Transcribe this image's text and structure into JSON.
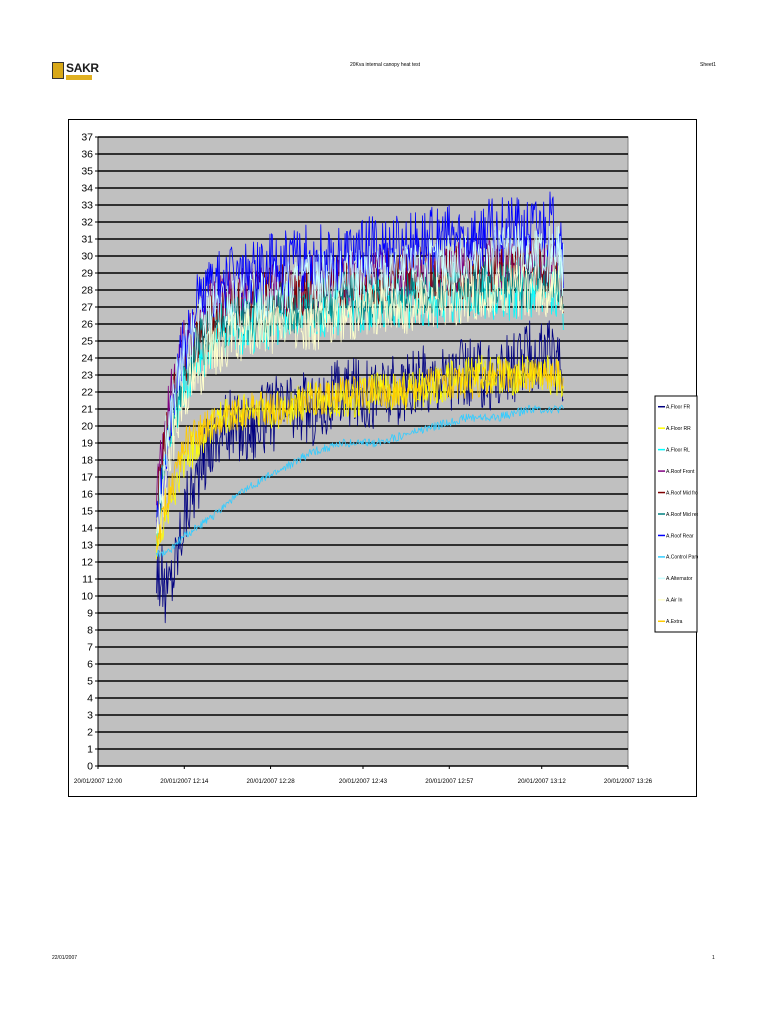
{
  "header": {
    "logo_text": "SAKR",
    "title": "20Kva internal canopy heat test",
    "sheet": "Sheet1"
  },
  "footer": {
    "date": "22/01/2007",
    "page": "1"
  },
  "chart_data": {
    "type": "line",
    "title": "",
    "xlabel": "",
    "ylabel": "",
    "ylim": [
      0,
      37
    ],
    "yticks": [
      "0",
      "1",
      "2",
      "3",
      "4",
      "5",
      "6",
      "7",
      "8",
      "9",
      "10",
      "11",
      "12",
      "13",
      "14",
      "15",
      "16",
      "17",
      "18",
      "19",
      "20",
      "21",
      "22",
      "23",
      "24",
      "25",
      "26",
      "27",
      "28",
      "29",
      "30",
      "31",
      "32",
      "33",
      "34",
      "35",
      "36",
      "37"
    ],
    "xlim": [
      "20/01/2007 12:00",
      "20/01/2007 13:26"
    ],
    "xticks": [
      "20/01/2007 12:00",
      "20/01/2007 12:14",
      "20/01/2007 12:28",
      "20/01/2007 12:43",
      "20/01/2007 12:57",
      "20/01/2007 13:12",
      "20/01/2007 13:26"
    ],
    "x_minutes": [
      9.5,
      11,
      12.5,
      14,
      16,
      18,
      21,
      25,
      30,
      35,
      40,
      45,
      50,
      55,
      60,
      65,
      70,
      75,
      75.5
    ],
    "plot_background": "#c0c0c0",
    "grid": "horizontal",
    "legend_position": "right",
    "series": [
      {
        "name": "A.Floor FR",
        "color": "#000080",
        "values": [
          12,
          10,
          12,
          15,
          17,
          19,
          20,
          20,
          21,
          21,
          22,
          22,
          22,
          23,
          23,
          23,
          24,
          24,
          23
        ]
      },
      {
        "name": "A.Floor RR",
        "color": "#ffff00",
        "values": [
          13,
          15,
          16,
          18,
          19,
          20,
          20.5,
          21,
          21,
          21.5,
          21.5,
          22,
          22,
          22.5,
          23,
          23,
          23,
          23,
          22
        ]
      },
      {
        "name": "A.Floor RL",
        "color": "#00ffff",
        "values": [
          14,
          18,
          21,
          23,
          24,
          25,
          26,
          26,
          26.5,
          27,
          27,
          27.5,
          27.5,
          27.5,
          28,
          28,
          28,
          28,
          27
        ]
      },
      {
        "name": "A.Roof Front",
        "color": "#800080",
        "values": [
          16,
          20,
          23,
          25,
          26,
          27,
          27.5,
          28,
          28,
          28.5,
          28.5,
          29,
          29,
          29,
          29.5,
          29.5,
          29.5,
          29.5,
          28
        ]
      },
      {
        "name": "A.Roof Mid front",
        "color": "#800000",
        "values": [
          15,
          19,
          22,
          24,
          25,
          26,
          27,
          27.5,
          28,
          28,
          28.5,
          28.5,
          29,
          29,
          29,
          29.5,
          29.5,
          29.5,
          28
        ]
      },
      {
        "name": "A.Roof Mid rear",
        "color": "#008080",
        "values": [
          14,
          18,
          21,
          23,
          24.5,
          25.5,
          26,
          26.5,
          27,
          27,
          27.5,
          27.5,
          28,
          28,
          28,
          28.5,
          28.5,
          28.5,
          27
        ]
      },
      {
        "name": "A.Roof Rear",
        "color": "#0000ff",
        "values": [
          14,
          18,
          22,
          25,
          27,
          28,
          28.5,
          29,
          29.5,
          30,
          30,
          30.5,
          30.5,
          31,
          31,
          31.5,
          31.5,
          32,
          30
        ]
      },
      {
        "name": "A.Control Panel",
        "color": "#33ccff",
        "values": [
          12.5,
          12.5,
          13,
          13.5,
          14,
          14.5,
          15.5,
          16.5,
          17.5,
          18.5,
          19,
          19,
          19.5,
          20,
          20.5,
          20.5,
          21,
          21,
          21
        ]
      },
      {
        "name": "A.Alternator",
        "color": "#ccffff",
        "values": [
          14,
          19,
          22,
          24,
          25.5,
          26.5,
          27,
          27.5,
          28,
          28.5,
          28.5,
          29,
          29,
          29.5,
          29.5,
          30,
          30,
          30,
          29
        ]
      },
      {
        "name": "A.Air In",
        "color": "#ffffcc",
        "values": [
          13,
          17,
          20,
          22,
          23,
          24,
          25,
          25.5,
          26,
          26,
          26.5,
          27,
          27,
          27.5,
          27.5,
          28,
          28,
          28,
          27
        ]
      },
      {
        "name": "A.Extra",
        "color": "#ffcc00",
        "values": [
          13,
          15.5,
          17,
          19,
          19.5,
          20,
          20.5,
          21,
          21,
          21.5,
          22,
          22,
          22,
          22.5,
          22.5,
          23,
          23,
          23,
          22
        ]
      }
    ]
  }
}
